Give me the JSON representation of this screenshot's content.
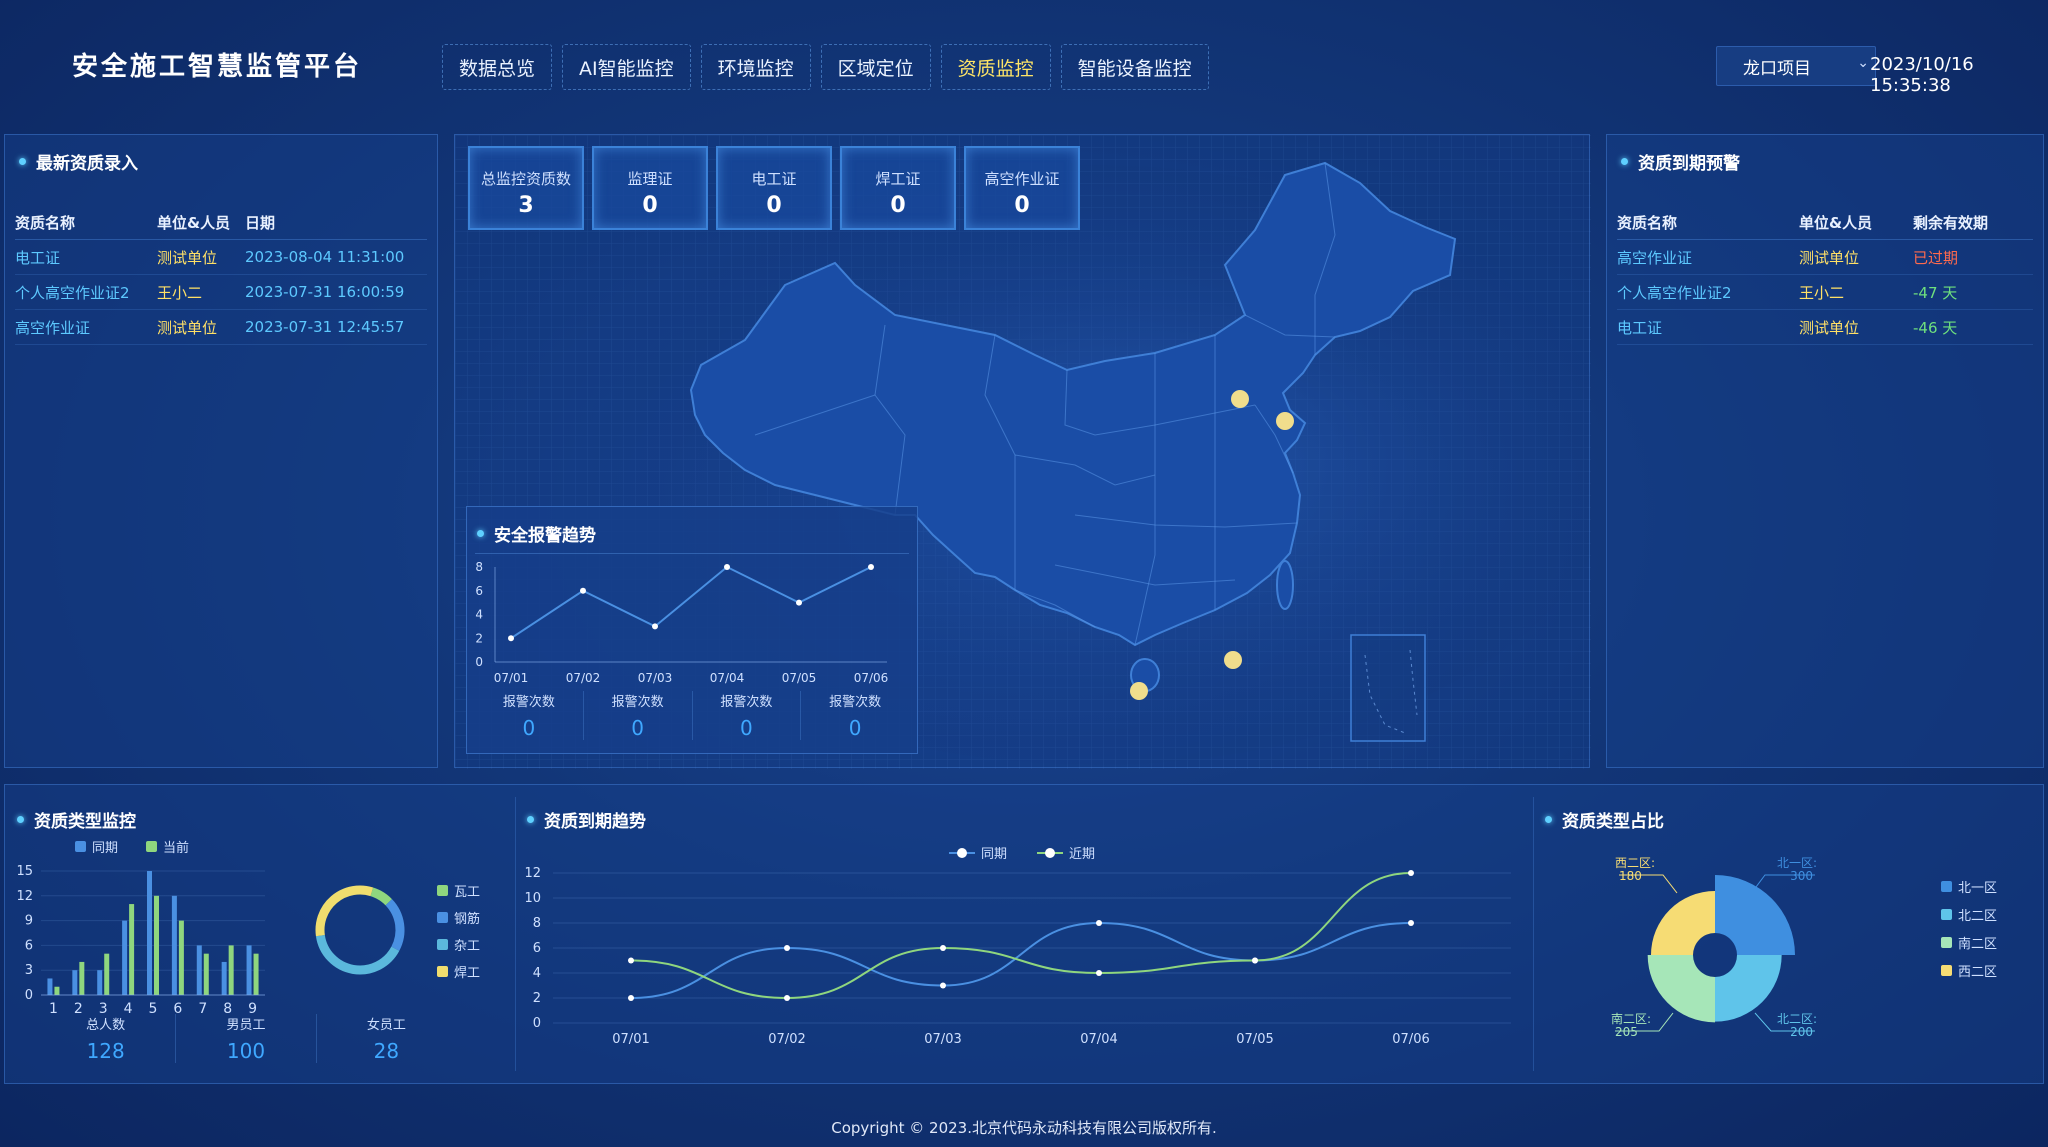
{
  "header": {
    "title": "安全施工智慧监管平台",
    "tabs": [
      {
        "label": "数据总览"
      },
      {
        "label": "AI智能监控"
      },
      {
        "label": "环境监控"
      },
      {
        "label": "区域定位"
      },
      {
        "label": "资质监控"
      },
      {
        "label": "智能设备监控"
      }
    ],
    "active_tab": "资质监控",
    "project": "龙口项目",
    "datetime": "2023/10/16 15:35:38"
  },
  "latest": {
    "title": "最新资质录入",
    "columns": [
      "资质名称",
      "单位&人员",
      "日期"
    ],
    "rows": [
      {
        "name": "电工证",
        "unit": "测试单位",
        "date": "2023-08-04 11:31:00"
      },
      {
        "name": "个人高空作业证2",
        "unit": "王小二",
        "date": "2023-07-31 16:00:59"
      },
      {
        "name": "高空作业证",
        "unit": "测试单位",
        "date": "2023-07-31 12:45:57"
      }
    ]
  },
  "stats": [
    {
      "label": "总监控资质数",
      "value": "3"
    },
    {
      "label": "监理证",
      "value": "0"
    },
    {
      "label": "电工证",
      "value": "0"
    },
    {
      "label": "焊工证",
      "value": "0"
    },
    {
      "label": "高空作业证",
      "value": "0"
    }
  ],
  "alarm": {
    "title": "安全报警趋势",
    "counts": [
      {
        "label": "报警次数",
        "value": "0"
      },
      {
        "label": "报警次数",
        "value": "0"
      },
      {
        "label": "报警次数",
        "value": "0"
      },
      {
        "label": "报警次数",
        "value": "0"
      }
    ]
  },
  "expiry_warning": {
    "title": "资质到期预警",
    "columns": [
      "资质名称",
      "单位&人员",
      "剩余有效期"
    ],
    "rows": [
      {
        "name": "高空作业证",
        "unit": "测试单位",
        "remain": "已过期",
        "status": "expired"
      },
      {
        "name": "个人高空作业证2",
        "unit": "王小二",
        "remain": "-47 天",
        "status": "days"
      },
      {
        "name": "电工证",
        "unit": "测试单位",
        "remain": "-46 天",
        "status": "days"
      }
    ]
  },
  "type_monitor": {
    "title": "资质类型监控",
    "employees": [
      {
        "label": "总人数",
        "value": "128"
      },
      {
        "label": "男员工",
        "value": "100"
      },
      {
        "label": "女员工",
        "value": "28"
      }
    ]
  },
  "expiry_trend": {
    "title": "资质到期趋势"
  },
  "type_ratio": {
    "title": "资质类型占比"
  },
  "footer": "Copyright © 2023.北京代码永动科技有限公司版权所有.",
  "colors": {
    "accent_yellow": "#ffe066",
    "accent_blue": "#4a90e2",
    "accent_green": "#8fd67e",
    "expired": "#ff6a4d"
  },
  "chart_data": [
    {
      "type": "line",
      "title": "安全报警趋势",
      "x": [
        "07/01",
        "07/02",
        "07/03",
        "07/04",
        "07/05",
        "07/06"
      ],
      "ylim": [
        0,
        8
      ],
      "yticks": [
        0,
        2,
        4,
        6,
        8
      ],
      "series": [
        {
          "values": [
            2,
            6,
            3,
            8,
            5,
            8
          ]
        }
      ]
    },
    {
      "type": "bar",
      "title": "资质类型监控",
      "categories": [
        "1",
        "2",
        "3",
        "4",
        "5",
        "6",
        "7",
        "8",
        "9"
      ],
      "ylim": [
        0,
        15
      ],
      "yticks": [
        0,
        3,
        6,
        9,
        12,
        15
      ],
      "series": [
        {
          "name": "同期",
          "values": [
            2,
            3,
            3,
            9,
            15,
            12,
            6,
            4,
            6
          ]
        },
        {
          "name": "当前",
          "values": [
            1,
            4,
            5,
            11,
            12,
            9,
            5,
            6,
            5
          ]
        }
      ]
    },
    {
      "type": "pie",
      "categories": [
        "瓦工",
        "钢筋",
        "杂工",
        "焊工"
      ],
      "values": [
        8,
        20,
        40,
        32
      ]
    },
    {
      "type": "line",
      "title": "资质到期趋势",
      "x": [
        "07/01",
        "07/02",
        "07/03",
        "07/04",
        "07/05",
        "07/06"
      ],
      "ylim": [
        0,
        12
      ],
      "yticks": [
        0,
        2,
        4,
        6,
        8,
        10,
        12
      ],
      "series": [
        {
          "name": "同期",
          "values": [
            2,
            6,
            3,
            8,
            5,
            8
          ]
        },
        {
          "name": "近期",
          "values": [
            5,
            2,
            6,
            4,
            5,
            12
          ]
        }
      ]
    },
    {
      "type": "pie",
      "title": "资质类型占比",
      "categories": [
        "北一区",
        "北二区",
        "南二区",
        "西二区"
      ],
      "values": [
        300,
        200,
        205,
        180
      ],
      "labels": [
        "北一区:",
        "北二区:",
        "南二区:",
        "西二区:"
      ]
    }
  ]
}
